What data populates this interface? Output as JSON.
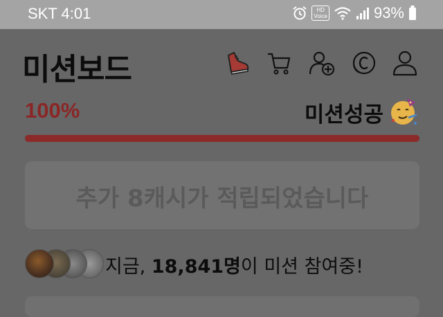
{
  "status_bar": {
    "carrier": "SKT",
    "time": "4:01",
    "hd_label": "HD",
    "voice_label": "Voice",
    "battery": "93%"
  },
  "header": {
    "title": "미션보드",
    "icons": [
      "shoe-icon",
      "cart-icon",
      "add-friend-icon",
      "coin-icon",
      "profile-icon"
    ]
  },
  "progress": {
    "percent_label": "100%",
    "status_label": "미션성공",
    "value": 1.0,
    "fill_color": "#8c2a2a"
  },
  "banner": {
    "text": "추가 8캐시가 적립되었습니다"
  },
  "participants": {
    "prefix": "지금, ",
    "count": "18,841명",
    "suffix": "이 미션 참여중!"
  }
}
